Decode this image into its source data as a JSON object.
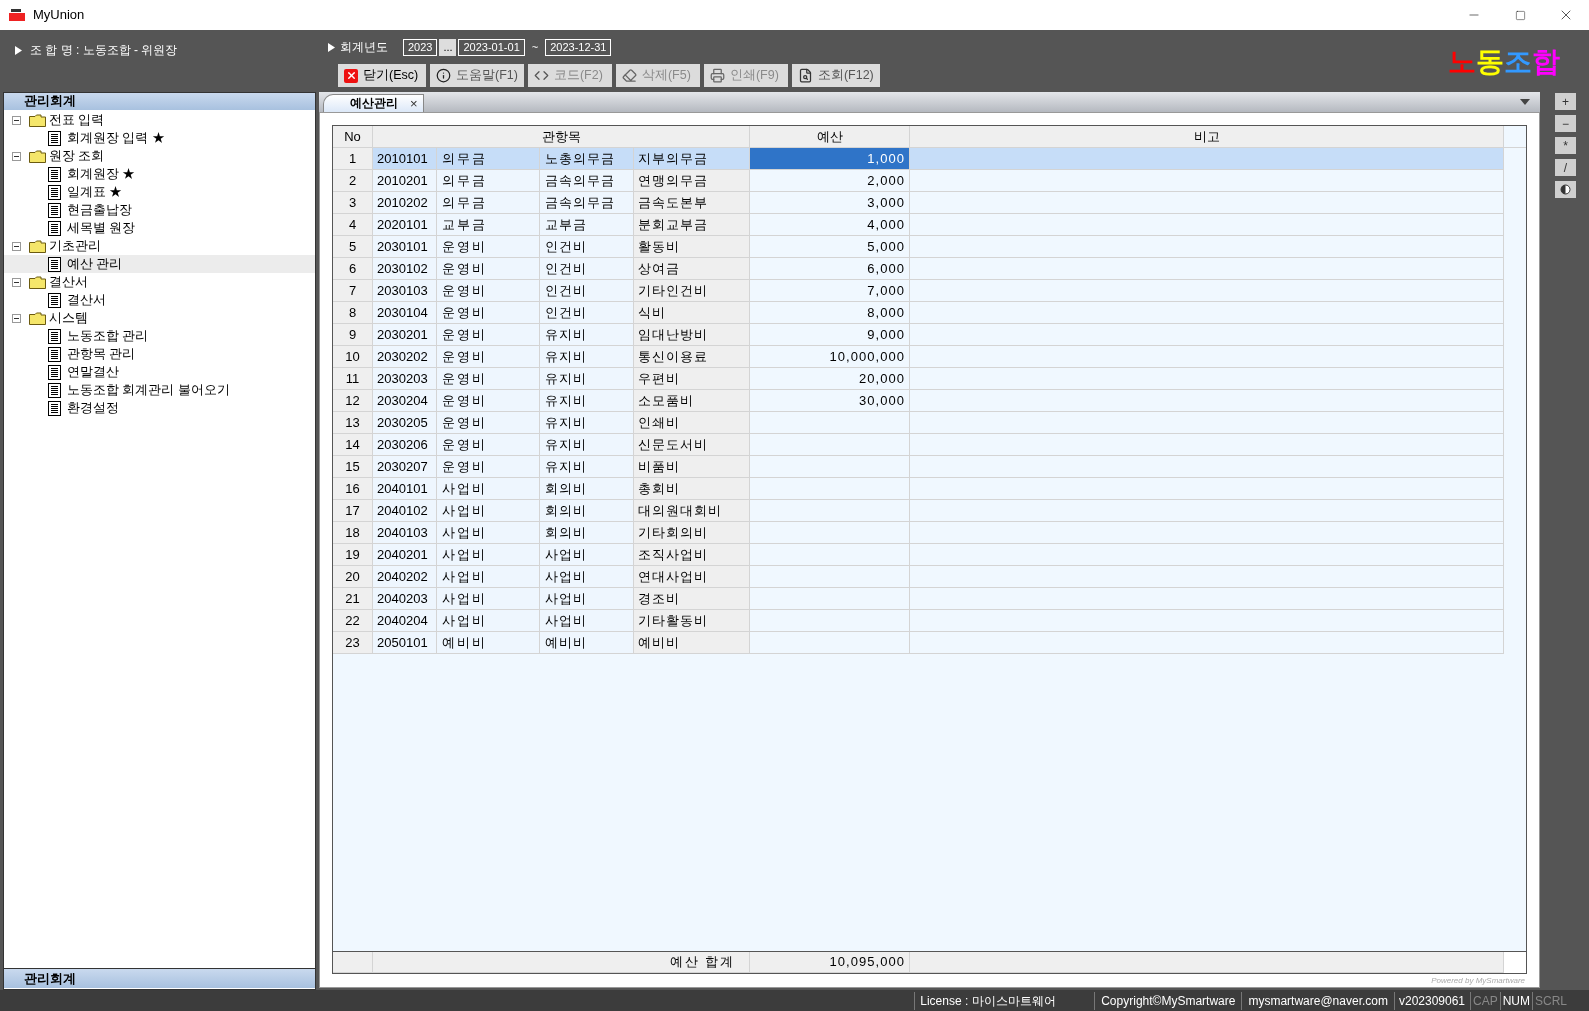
{
  "window": {
    "title": "MyUnion"
  },
  "header": {
    "union_label": "조 합 명 : 노동조합 - 위원장",
    "fiscal_label": "회계년도",
    "year": "2023",
    "picker": "...",
    "start_date": "2023-01-01",
    "range_sep": "~",
    "end_date": "2023-12-31"
  },
  "toolbar": [
    {
      "kind": "close",
      "label": "닫기(Esc)",
      "disabled": false
    },
    {
      "kind": "help",
      "label": "도움말(F1)",
      "disabled": false
    },
    {
      "kind": "code",
      "label": "코드(F2)",
      "disabled": true
    },
    {
      "kind": "delete",
      "label": "삭제(F5)",
      "disabled": true
    },
    {
      "kind": "print",
      "label": "인쇄(F9)",
      "disabled": true
    },
    {
      "kind": "search",
      "label": "조회(F12)",
      "disabled": false
    }
  ],
  "logo": [
    {
      "char": "노",
      "color": "#ff0000"
    },
    {
      "char": "동",
      "color": "#ffff00"
    },
    {
      "char": "조",
      "color": "#3399ff"
    },
    {
      "char": "합",
      "color": "#ff00ff"
    }
  ],
  "sidebar": {
    "title": "관리회계",
    "footer": "관리회계",
    "tree": [
      {
        "label": "전표 입력",
        "expanded": true,
        "children": [
          {
            "label": "회계원장 입력 ★",
            "selected": false
          }
        ]
      },
      {
        "label": "원장 조회",
        "expanded": true,
        "children": [
          {
            "label": "회계원장 ★",
            "selected": false
          },
          {
            "label": "일계표 ★",
            "selected": false
          },
          {
            "label": "현금출납장",
            "selected": false
          },
          {
            "label": "세목별 원장",
            "selected": false
          }
        ]
      },
      {
        "label": "기초관리",
        "expanded": true,
        "children": [
          {
            "label": "예산 관리",
            "selected": true
          }
        ]
      },
      {
        "label": "결산서",
        "expanded": true,
        "children": [
          {
            "label": "결산서",
            "selected": false
          }
        ]
      },
      {
        "label": "시스템",
        "expanded": true,
        "children": [
          {
            "label": "노동조합 관리",
            "selected": false
          },
          {
            "label": "관항목 관리",
            "selected": false
          },
          {
            "label": "연말결산",
            "selected": false
          },
          {
            "label": "노동조합 회계관리 불어오기",
            "selected": false
          },
          {
            "label": "환경설정",
            "selected": false
          }
        ]
      }
    ]
  },
  "tabs": [
    {
      "label": "예산관리",
      "close": "×",
      "selected": true
    }
  ],
  "table": {
    "columns": [
      "No",
      "관항목",
      "예산",
      "비고"
    ],
    "rows": [
      {
        "no": "1",
        "code": "2010101",
        "c1": "의무금",
        "c2": "노총의무금",
        "c3": "지부의무금",
        "budget": "1,000",
        "selected": true
      },
      {
        "no": "2",
        "code": "2010201",
        "c1": "의무금",
        "c2": "금속의무금",
        "c3": "연맹의무금",
        "budget": "2,000",
        "selected": false
      },
      {
        "no": "3",
        "code": "2010202",
        "c1": "의무금",
        "c2": "금속의무금",
        "c3": "금속도본부",
        "budget": "3,000",
        "selected": false
      },
      {
        "no": "4",
        "code": "2020101",
        "c1": "교부금",
        "c2": "교부금",
        "c3": "분회교부금",
        "budget": "4,000",
        "selected": false
      },
      {
        "no": "5",
        "code": "2030101",
        "c1": "운영비",
        "c2": "인건비",
        "c3": "활동비",
        "budget": "5,000",
        "selected": false
      },
      {
        "no": "6",
        "code": "2030102",
        "c1": "운영비",
        "c2": "인건비",
        "c3": "상여금",
        "budget": "6,000",
        "selected": false
      },
      {
        "no": "7",
        "code": "2030103",
        "c1": "운영비",
        "c2": "인건비",
        "c3": "기타인건비",
        "budget": "7,000",
        "selected": false
      },
      {
        "no": "8",
        "code": "2030104",
        "c1": "운영비",
        "c2": "인건비",
        "c3": "식비",
        "budget": "8,000",
        "selected": false
      },
      {
        "no": "9",
        "code": "2030201",
        "c1": "운영비",
        "c2": "유지비",
        "c3": "임대난방비",
        "budget": "9,000",
        "selected": false
      },
      {
        "no": "10",
        "code": "2030202",
        "c1": "운영비",
        "c2": "유지비",
        "c3": "통신이용료",
        "budget": "10,000,000",
        "selected": false
      },
      {
        "no": "11",
        "code": "2030203",
        "c1": "운영비",
        "c2": "유지비",
        "c3": "우편비",
        "budget": "20,000",
        "selected": false
      },
      {
        "no": "12",
        "code": "2030204",
        "c1": "운영비",
        "c2": "유지비",
        "c3": "소모품비",
        "budget": "30,000",
        "selected": false
      },
      {
        "no": "13",
        "code": "2030205",
        "c1": "운영비",
        "c2": "유지비",
        "c3": "인쇄비",
        "selected": false
      },
      {
        "no": "14",
        "code": "2030206",
        "c1": "운영비",
        "c2": "유지비",
        "c3": "신문도서비",
        "selected": false
      },
      {
        "no": "15",
        "code": "2030207",
        "c1": "운영비",
        "c2": "유지비",
        "c3": "비품비",
        "selected": false
      },
      {
        "no": "16",
        "code": "2040101",
        "c1": "사업비",
        "c2": "회의비",
        "c3": "총회비",
        "selected": false
      },
      {
        "no": "17",
        "code": "2040102",
        "c1": "사업비",
        "c2": "회의비",
        "c3": "대의원대회비",
        "selected": false
      },
      {
        "no": "18",
        "code": "2040103",
        "c1": "사업비",
        "c2": "회의비",
        "c3": "기타회의비",
        "selected": false
      },
      {
        "no": "19",
        "code": "2040201",
        "c1": "사업비",
        "c2": "사업비",
        "c3": "조직사업비",
        "selected": false
      },
      {
        "no": "20",
        "code": "2040202",
        "c1": "사업비",
        "c2": "사업비",
        "c3": "연대사업비",
        "selected": false
      },
      {
        "no": "21",
        "code": "2040203",
        "c1": "사업비",
        "c2": "사업비",
        "c3": "경조비",
        "selected": false
      },
      {
        "no": "22",
        "code": "2040204",
        "c1": "사업비",
        "c2": "사업비",
        "c3": "기타활동비",
        "selected": false
      },
      {
        "no": "23",
        "code": "2050101",
        "c1": "예비비",
        "c2": "예비비",
        "c3": "예비비",
        "selected": false
      }
    ],
    "footer": {
      "label": "예산 합계",
      "total": "10,095,000"
    }
  },
  "powered_by": "Powered by MySmartware",
  "side_tools": [
    {
      "kind": "text",
      "label": "+"
    },
    {
      "kind": "text",
      "label": "−"
    },
    {
      "kind": "text",
      "label": "*"
    },
    {
      "kind": "text",
      "label": "/"
    },
    {
      "kind": "contrast"
    }
  ],
  "status_bar": {
    "license": "License : 마이스마트웨어",
    "copyright": "Copyright©MySmartware",
    "email": "mysmartware@naver.com",
    "version": "v202309061",
    "keys": [
      {
        "label": "CAP",
        "on": false
      },
      {
        "label": "NUM",
        "on": true
      },
      {
        "label": "SCRL",
        "on": false
      }
    ]
  }
}
